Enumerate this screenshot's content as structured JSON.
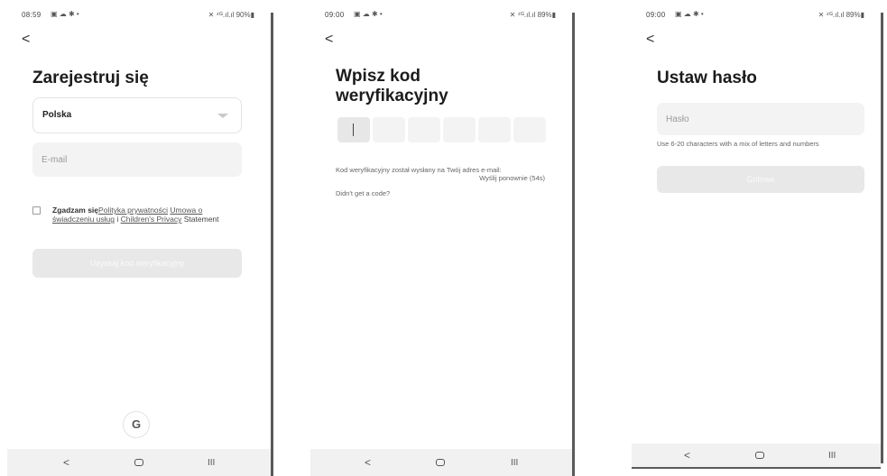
{
  "screen1": {
    "status": {
      "time": "08:59",
      "icons_left": "▣ ☁ ✱ •",
      "icons_right": "✕ ⁴ᴳ.ıl.ıl 90%▮"
    },
    "back_glyph": "<",
    "title": "Zarejestruj się",
    "country": "Polska",
    "email_placeholder": "E-mail",
    "consent": {
      "agree": "Zgadzam się",
      "link_privacy": "Polityka prywatności",
      "link_terms": "Umowa o świadczeniu usług",
      "and": "i",
      "link_children": "Children's Privacy",
      "statement": "Statement"
    },
    "submit_label": "Uzyskaj kod weryfikacyjny",
    "google_glyph": "G",
    "nav": {
      "back": "<",
      "recent": "III"
    }
  },
  "screen2": {
    "status": {
      "time": "09:00",
      "icons_left": "▣ ☁ ✱ •",
      "icons_right": "✕ ⁴ᴳ.ıl.ıl 89%▮"
    },
    "back_glyph": "<",
    "title_line1": "Wpisz kod",
    "title_line2": "weryfikacyjny",
    "sent_text": "Kod weryfikacyjny został wysłany na Twój adres e-mail:",
    "resend_text": "Wyślij ponownie (54s)",
    "no_code": "Didn't get a code?",
    "nav": {
      "back": "<",
      "recent": "III"
    }
  },
  "screen3": {
    "status": {
      "time": "09:00",
      "icons_left": "▣ ☁ ✱ •",
      "icons_right": "✕ ⁴ᴳ.ıl.ıl 89%▮"
    },
    "back_glyph": "<",
    "title": "Ustaw hasło",
    "password_placeholder": "Hasło",
    "hint": "Use 6-20 characters with a mix of letters and numbers",
    "done_label": "Gotowe",
    "nav": {
      "back": "<",
      "recent": "III"
    }
  },
  "colors": {
    "field_bg": "#f3f3f3",
    "disabled_btn": "#e8e8e8",
    "nav_bg": "#f1f1f1"
  }
}
